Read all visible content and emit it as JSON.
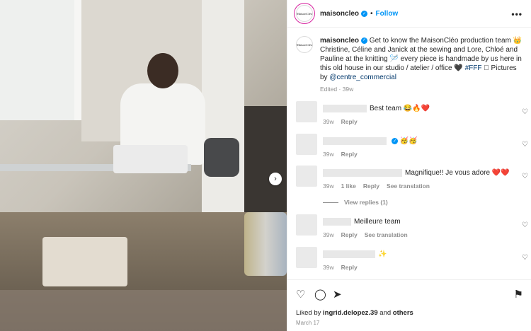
{
  "post": {
    "username": "maisoncleo",
    "follow_label": "Follow",
    "dot": "•",
    "more_label": "•••",
    "avatar_text": "MaisonCléo"
  },
  "caption": {
    "username": "maisoncleo",
    "text_1": " Get to know the MaisonCléo production team 👑 Christine, Céline and Janick at the sewing and Lore, Chloé and Pauline at the knitting 🪡 every piece is handmade by us here in this old house in our studio / atelier / office 🖤 ",
    "hashtag": "#FFF",
    "text_2": " 🏼 Pictures by ",
    "mention": "@centre_commercial",
    "meta": "Edited · 39w"
  },
  "comments": [
    {
      "text": "Best team 😂🔥❤️",
      "time": "39w",
      "actions": [
        "Reply"
      ]
    },
    {
      "text": "🥳🥳",
      "time": "39w",
      "actions": [
        "Reply"
      ]
    },
    {
      "text": "Magnifique!! Je vous adore ❤️❤️",
      "time": "39w",
      "likes": "1 like",
      "actions": [
        "Reply",
        "See translation"
      ]
    },
    {
      "text": "Meilleure team",
      "time": "39w",
      "actions": [
        "Reply",
        "See translation"
      ]
    },
    {
      "text": "✨",
      "time": "39w",
      "actions": [
        "Reply"
      ]
    }
  ],
  "view_replies": "View replies (1)",
  "liked_by": {
    "prefix": "Liked by ",
    "user": "ingrid.delopez.39",
    "middle": " and ",
    "others": "others"
  },
  "date": "March 17",
  "icons": {
    "verified": "verified-badge-icon",
    "heart": "heart-icon",
    "comment": "comment-icon",
    "share": "send-icon",
    "save": "bookmark-icon",
    "next": "chevron-right-icon"
  },
  "colors": {
    "accent": "#0095f6",
    "heart": "#ed4956"
  }
}
